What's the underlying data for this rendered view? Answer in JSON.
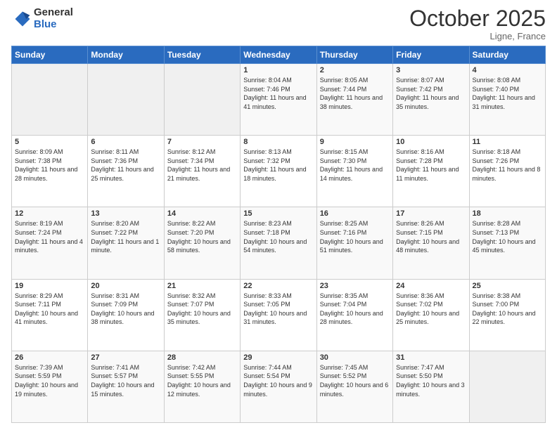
{
  "logo": {
    "general": "General",
    "blue": "Blue"
  },
  "header": {
    "month": "October 2025",
    "location": "Ligne, France"
  },
  "days_header": [
    "Sunday",
    "Monday",
    "Tuesday",
    "Wednesday",
    "Thursday",
    "Friday",
    "Saturday"
  ],
  "weeks": [
    [
      {
        "day": "",
        "sunrise": "",
        "sunset": "",
        "daylight": ""
      },
      {
        "day": "",
        "sunrise": "",
        "sunset": "",
        "daylight": ""
      },
      {
        "day": "",
        "sunrise": "",
        "sunset": "",
        "daylight": ""
      },
      {
        "day": "1",
        "sunrise": "Sunrise: 8:04 AM",
        "sunset": "Sunset: 7:46 PM",
        "daylight": "Daylight: 11 hours and 41 minutes."
      },
      {
        "day": "2",
        "sunrise": "Sunrise: 8:05 AM",
        "sunset": "Sunset: 7:44 PM",
        "daylight": "Daylight: 11 hours and 38 minutes."
      },
      {
        "day": "3",
        "sunrise": "Sunrise: 8:07 AM",
        "sunset": "Sunset: 7:42 PM",
        "daylight": "Daylight: 11 hours and 35 minutes."
      },
      {
        "day": "4",
        "sunrise": "Sunrise: 8:08 AM",
        "sunset": "Sunset: 7:40 PM",
        "daylight": "Daylight: 11 hours and 31 minutes."
      }
    ],
    [
      {
        "day": "5",
        "sunrise": "Sunrise: 8:09 AM",
        "sunset": "Sunset: 7:38 PM",
        "daylight": "Daylight: 11 hours and 28 minutes."
      },
      {
        "day": "6",
        "sunrise": "Sunrise: 8:11 AM",
        "sunset": "Sunset: 7:36 PM",
        "daylight": "Daylight: 11 hours and 25 minutes."
      },
      {
        "day": "7",
        "sunrise": "Sunrise: 8:12 AM",
        "sunset": "Sunset: 7:34 PM",
        "daylight": "Daylight: 11 hours and 21 minutes."
      },
      {
        "day": "8",
        "sunrise": "Sunrise: 8:13 AM",
        "sunset": "Sunset: 7:32 PM",
        "daylight": "Daylight: 11 hours and 18 minutes."
      },
      {
        "day": "9",
        "sunrise": "Sunrise: 8:15 AM",
        "sunset": "Sunset: 7:30 PM",
        "daylight": "Daylight: 11 hours and 14 minutes."
      },
      {
        "day": "10",
        "sunrise": "Sunrise: 8:16 AM",
        "sunset": "Sunset: 7:28 PM",
        "daylight": "Daylight: 11 hours and 11 minutes."
      },
      {
        "day": "11",
        "sunrise": "Sunrise: 8:18 AM",
        "sunset": "Sunset: 7:26 PM",
        "daylight": "Daylight: 11 hours and 8 minutes."
      }
    ],
    [
      {
        "day": "12",
        "sunrise": "Sunrise: 8:19 AM",
        "sunset": "Sunset: 7:24 PM",
        "daylight": "Daylight: 11 hours and 4 minutes."
      },
      {
        "day": "13",
        "sunrise": "Sunrise: 8:20 AM",
        "sunset": "Sunset: 7:22 PM",
        "daylight": "Daylight: 11 hours and 1 minute."
      },
      {
        "day": "14",
        "sunrise": "Sunrise: 8:22 AM",
        "sunset": "Sunset: 7:20 PM",
        "daylight": "Daylight: 10 hours and 58 minutes."
      },
      {
        "day": "15",
        "sunrise": "Sunrise: 8:23 AM",
        "sunset": "Sunset: 7:18 PM",
        "daylight": "Daylight: 10 hours and 54 minutes."
      },
      {
        "day": "16",
        "sunrise": "Sunrise: 8:25 AM",
        "sunset": "Sunset: 7:16 PM",
        "daylight": "Daylight: 10 hours and 51 minutes."
      },
      {
        "day": "17",
        "sunrise": "Sunrise: 8:26 AM",
        "sunset": "Sunset: 7:15 PM",
        "daylight": "Daylight: 10 hours and 48 minutes."
      },
      {
        "day": "18",
        "sunrise": "Sunrise: 8:28 AM",
        "sunset": "Sunset: 7:13 PM",
        "daylight": "Daylight: 10 hours and 45 minutes."
      }
    ],
    [
      {
        "day": "19",
        "sunrise": "Sunrise: 8:29 AM",
        "sunset": "Sunset: 7:11 PM",
        "daylight": "Daylight: 10 hours and 41 minutes."
      },
      {
        "day": "20",
        "sunrise": "Sunrise: 8:31 AM",
        "sunset": "Sunset: 7:09 PM",
        "daylight": "Daylight: 10 hours and 38 minutes."
      },
      {
        "day": "21",
        "sunrise": "Sunrise: 8:32 AM",
        "sunset": "Sunset: 7:07 PM",
        "daylight": "Daylight: 10 hours and 35 minutes."
      },
      {
        "day": "22",
        "sunrise": "Sunrise: 8:33 AM",
        "sunset": "Sunset: 7:05 PM",
        "daylight": "Daylight: 10 hours and 31 minutes."
      },
      {
        "day": "23",
        "sunrise": "Sunrise: 8:35 AM",
        "sunset": "Sunset: 7:04 PM",
        "daylight": "Daylight: 10 hours and 28 minutes."
      },
      {
        "day": "24",
        "sunrise": "Sunrise: 8:36 AM",
        "sunset": "Sunset: 7:02 PM",
        "daylight": "Daylight: 10 hours and 25 minutes."
      },
      {
        "day": "25",
        "sunrise": "Sunrise: 8:38 AM",
        "sunset": "Sunset: 7:00 PM",
        "daylight": "Daylight: 10 hours and 22 minutes."
      }
    ],
    [
      {
        "day": "26",
        "sunrise": "Sunrise: 7:39 AM",
        "sunset": "Sunset: 5:59 PM",
        "daylight": "Daylight: 10 hours and 19 minutes."
      },
      {
        "day": "27",
        "sunrise": "Sunrise: 7:41 AM",
        "sunset": "Sunset: 5:57 PM",
        "daylight": "Daylight: 10 hours and 15 minutes."
      },
      {
        "day": "28",
        "sunrise": "Sunrise: 7:42 AM",
        "sunset": "Sunset: 5:55 PM",
        "daylight": "Daylight: 10 hours and 12 minutes."
      },
      {
        "day": "29",
        "sunrise": "Sunrise: 7:44 AM",
        "sunset": "Sunset: 5:54 PM",
        "daylight": "Daylight: 10 hours and 9 minutes."
      },
      {
        "day": "30",
        "sunrise": "Sunrise: 7:45 AM",
        "sunset": "Sunset: 5:52 PM",
        "daylight": "Daylight: 10 hours and 6 minutes."
      },
      {
        "day": "31",
        "sunrise": "Sunrise: 7:47 AM",
        "sunset": "Sunset: 5:50 PM",
        "daylight": "Daylight: 10 hours and 3 minutes."
      },
      {
        "day": "",
        "sunrise": "",
        "sunset": "",
        "daylight": ""
      }
    ]
  ]
}
